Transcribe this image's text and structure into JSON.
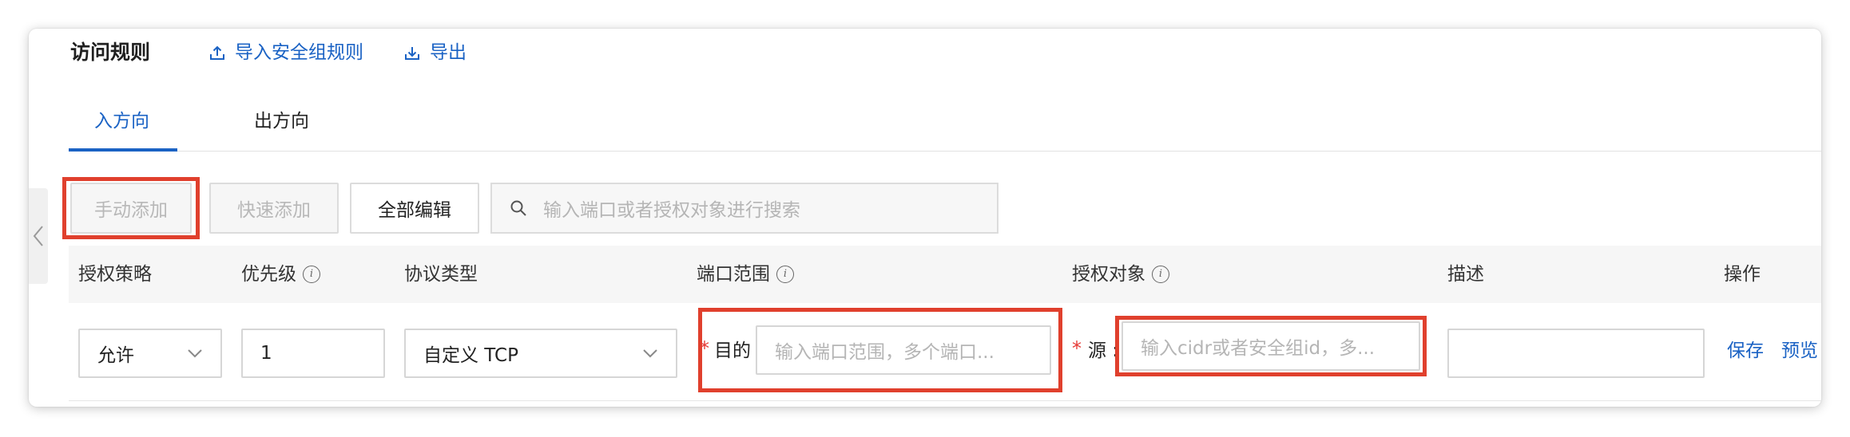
{
  "header": {
    "title": "访问规则",
    "import_label": "导入安全组规则",
    "export_label": "导出"
  },
  "tabs": [
    {
      "label": "入方向",
      "active": true
    },
    {
      "label": "出方向",
      "active": false
    }
  ],
  "toolbar": {
    "manual_add": "手动添加",
    "quick_add": "快速添加",
    "edit_all": "全部编辑",
    "search_placeholder": "输入端口或者授权对象进行搜索"
  },
  "columns": [
    "授权策略",
    "优先级",
    "协议类型",
    "端口范围",
    "授权对象",
    "描述",
    "操作"
  ],
  "row": {
    "policy": "允许",
    "priority": "1",
    "protocol": "自定义 TCP",
    "port_label": "目的",
    "port_placeholder": "输入端口范围，多个端口...",
    "source_label": "源 :",
    "source_placeholder": "输入cidr或者安全组id，多...",
    "description": "",
    "actions": [
      "保存",
      "预览"
    ]
  },
  "colors": {
    "accent": "#1a62c4",
    "highlight_box": "#e0402d",
    "required": "#e53935"
  }
}
